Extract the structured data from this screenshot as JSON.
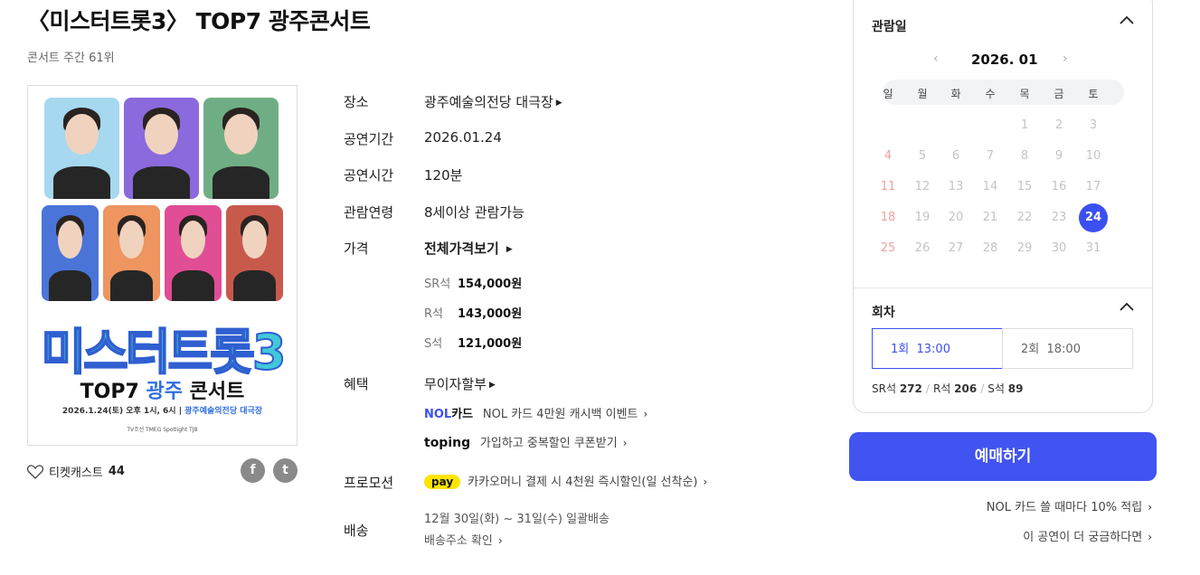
{
  "title": "〈미스터트롯3〉 TOP7 광주콘서트",
  "rank": "콘서트 주간 61위",
  "poster": {
    "logo": "미스터트롯3",
    "sub_prefix": "TOP7",
    "sub_city": "광주",
    "sub_suffix": "콘서트",
    "date_line": "2026.1.24(토) 오후 1시, 6시 |",
    "venue_line": "광주예술의전당 대극장",
    "sponsors": "TV조선  TMEG  Spotlight  TJB"
  },
  "ticketcast": {
    "label": "티켓캐스트",
    "count": "44"
  },
  "social": {
    "facebook": "f",
    "twitter": "t"
  },
  "info": {
    "venue_label": "장소",
    "venue": "광주예술의전당 대극장",
    "period_label": "공연기간",
    "period": "2026.01.24",
    "runtime_label": "공연시간",
    "runtime": "120분",
    "age_label": "관람연령",
    "age": "8세이상 관람가능",
    "price_label": "가격",
    "price_all": "전체가격보기",
    "prices": [
      {
        "grade": "SR석",
        "amount": "154,000원"
      },
      {
        "grade": "R석",
        "amount": "143,000원"
      },
      {
        "grade": "S석",
        "amount": "121,000원"
      }
    ],
    "benefit_label": "혜택",
    "benefit": "무이자할부",
    "nol_logo": "NOL",
    "nol_logo_suffix": "카드",
    "nol_text": "NOL 카드 4만원 캐시백 이벤트",
    "toping_logo": "toping",
    "toping_text": "가입하고 중복할인 쿠폰받기",
    "promo_label": "프로모션",
    "pay_badge": "pay",
    "pay_text": "카카오머니 결제 시 4천원 즉시할인(일 선착순)",
    "ship_label": "배송",
    "ship_date": "12월 30일(화) ~ 31일(수) 일괄배송",
    "ship_addr": "배송주소 확인"
  },
  "calendar": {
    "label": "관람일",
    "month": "2026. 01",
    "weekdays": [
      "일",
      "월",
      "화",
      "수",
      "목",
      "금",
      "토"
    ],
    "weeks": [
      [
        "",
        "",
        "",
        "",
        "1",
        "2",
        "3"
      ],
      [
        "4",
        "5",
        "6",
        "7",
        "8",
        "9",
        "10"
      ],
      [
        "11",
        "12",
        "13",
        "14",
        "15",
        "16",
        "17"
      ],
      [
        "18",
        "19",
        "20",
        "21",
        "22",
        "23",
        "24"
      ],
      [
        "25",
        "26",
        "27",
        "28",
        "29",
        "30",
        "31"
      ]
    ],
    "selected_day": "24"
  },
  "round": {
    "label": "회차",
    "options": [
      {
        "no": "1회",
        "time": "13:00",
        "selected": true
      },
      {
        "no": "2회",
        "time": "18:00",
        "selected": false
      }
    ],
    "seats": [
      {
        "grade": "SR석",
        "count": "272"
      },
      {
        "grade": "R석",
        "count": "206"
      },
      {
        "grade": "S석",
        "count": "89"
      }
    ]
  },
  "book_button": "예매하기",
  "nol_promo": "NOL 카드 쓸 때마다 10% 적립",
  "more_link": "이 공연이 더 궁금하다면",
  "colors": {
    "accent": "#4154f1",
    "sunday": "#f0a0a0",
    "kakao": "#ffe400"
  }
}
